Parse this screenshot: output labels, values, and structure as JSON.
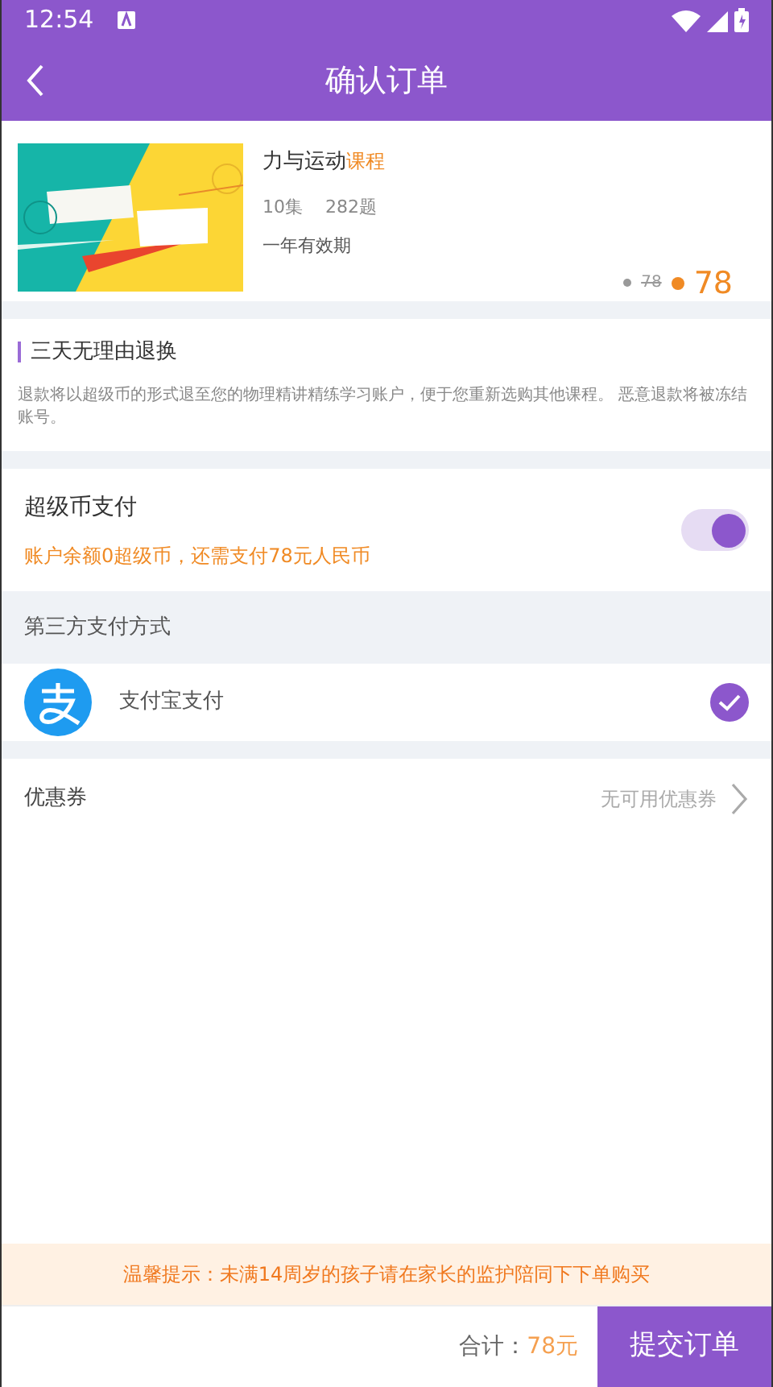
{
  "status_bar": {
    "time": "12:54"
  },
  "app_bar": {
    "title": "确认订单"
  },
  "course": {
    "kind": "picture",
    "title": "力与运动",
    "tag": "课程",
    "episodes": "10集",
    "questions": "282题",
    "validity": "一年有效期",
    "original_price": "78",
    "price": "78"
  },
  "refund": {
    "title": "三天无理由退换",
    "body": "退款将以超级币的形式退至您的物理精讲精练学习账户，便于您重新选购其他课程。 恶意退款将被冻结账号。"
  },
  "coin_pay": {
    "label": "超级币支付",
    "note": "账户余额0超级币，还需支付78元人民币",
    "on": true
  },
  "third_party": {
    "header": "第三方支付方式",
    "methods": [
      {
        "name": "支付宝支付",
        "selected": true
      }
    ]
  },
  "coupon": {
    "label": "优惠券",
    "value": "无可用优惠券"
  },
  "notice": {
    "text": "温馨提示：未满14周岁的孩子请在家长的监护陪同下下单购买"
  },
  "footer": {
    "total_label": "合计：",
    "total": "78元",
    "submit": "提交订单"
  }
}
